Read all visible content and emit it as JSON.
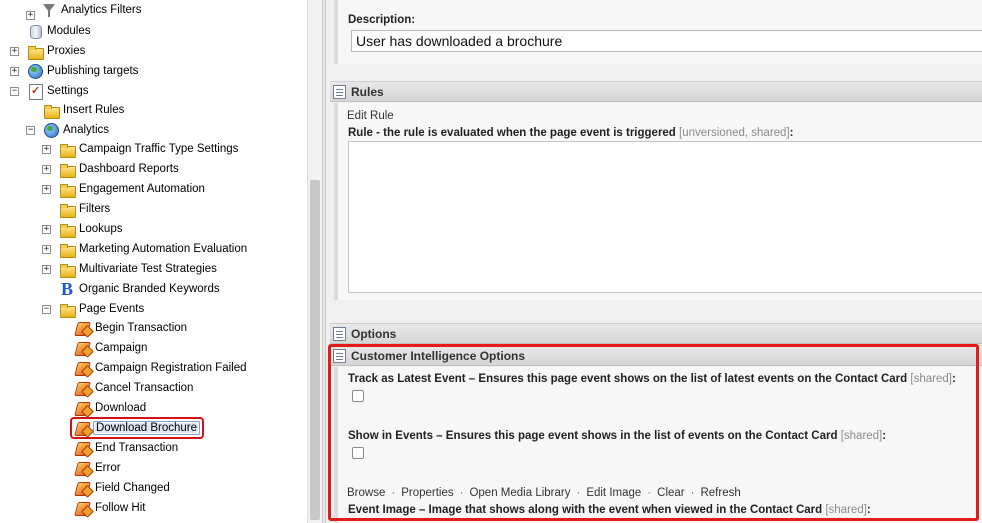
{
  "tree": {
    "items": [
      {
        "label": "Analytics Filters",
        "icon": "funnel-icon",
        "expander": "+"
      },
      {
        "label": "Modules",
        "icon": "module-icon",
        "expander": ""
      },
      {
        "label": "Proxies",
        "icon": "folder-icon",
        "expander": "+"
      },
      {
        "label": "Publishing targets",
        "icon": "globe-icon",
        "expander": "+"
      },
      {
        "label": "Settings",
        "icon": "settings-icon",
        "expander": "-"
      },
      {
        "label": "Insert Rules",
        "icon": "folder-icon",
        "expander": ""
      },
      {
        "label": "Analytics",
        "icon": "analytics-icon",
        "expander": "-"
      },
      {
        "label": "Campaign Traffic Type Settings",
        "icon": "folder-icon",
        "expander": "+"
      },
      {
        "label": "Dashboard Reports",
        "icon": "folder-icon",
        "expander": "+"
      },
      {
        "label": "Engagement Automation",
        "icon": "folder-icon",
        "expander": "+"
      },
      {
        "label": "Filters",
        "icon": "folder-icon",
        "expander": ""
      },
      {
        "label": "Lookups",
        "icon": "folder-icon",
        "expander": "+"
      },
      {
        "label": "Marketing Automation Evaluation",
        "icon": "folder-icon",
        "expander": "+"
      },
      {
        "label": "Multivariate Test Strategies",
        "icon": "folder-icon",
        "expander": "+"
      },
      {
        "label": "Organic Branded Keywords",
        "icon": "b-icon",
        "expander": ""
      },
      {
        "label": "Page Events",
        "icon": "folder-icon",
        "expander": "-"
      },
      {
        "label": "Begin Transaction",
        "icon": "page-event-icon",
        "expander": ""
      },
      {
        "label": "Campaign",
        "icon": "page-event-icon",
        "expander": ""
      },
      {
        "label": "Campaign Registration Failed",
        "icon": "page-event-icon",
        "expander": ""
      },
      {
        "label": "Cancel Transaction",
        "icon": "page-event-icon",
        "expander": ""
      },
      {
        "label": "Download",
        "icon": "page-event-icon",
        "expander": ""
      },
      {
        "label": "Download Brochure",
        "icon": "page-event-icon",
        "expander": "",
        "selected": true
      },
      {
        "label": "End Transaction",
        "icon": "page-event-icon",
        "expander": ""
      },
      {
        "label": "Error",
        "icon": "page-event-icon",
        "expander": ""
      },
      {
        "label": "Field Changed",
        "icon": "page-event-icon",
        "expander": ""
      },
      {
        "label": "Follow Hit",
        "icon": "page-event-icon",
        "expander": ""
      }
    ]
  },
  "description": {
    "label": "Description:",
    "value": "User has downloaded a brochure"
  },
  "rules": {
    "title": "Rules",
    "edit_link": "Edit Rule",
    "field_label": "Rule - the rule is evaluated when the page event is triggered",
    "field_meta": "[unversioned, shared]",
    "colon": ":"
  },
  "options": {
    "title": "Options"
  },
  "ci_options": {
    "title": "Customer Intelligence Options",
    "track_label": "Track as Latest Event – Ensures this page event shows on the list of latest events on the Contact Card",
    "track_meta": "[shared]",
    "track_checked": false,
    "show_label": "Show in Events – Ensures this page event shows in the list of events on the Contact Card",
    "show_meta": "[shared]",
    "show_checked": false,
    "actions": [
      "Browse",
      "Properties",
      "Open Media Library",
      "Edit Image",
      "Clear",
      "Refresh"
    ],
    "separator": "·",
    "image_label": "Event Image – Image that shows along with the event when viewed in the Contact Card",
    "image_meta": "[shared]",
    "colon": ":"
  },
  "colors": {
    "highlight": "#e21b1b",
    "section_header": "#d6d6d6"
  }
}
